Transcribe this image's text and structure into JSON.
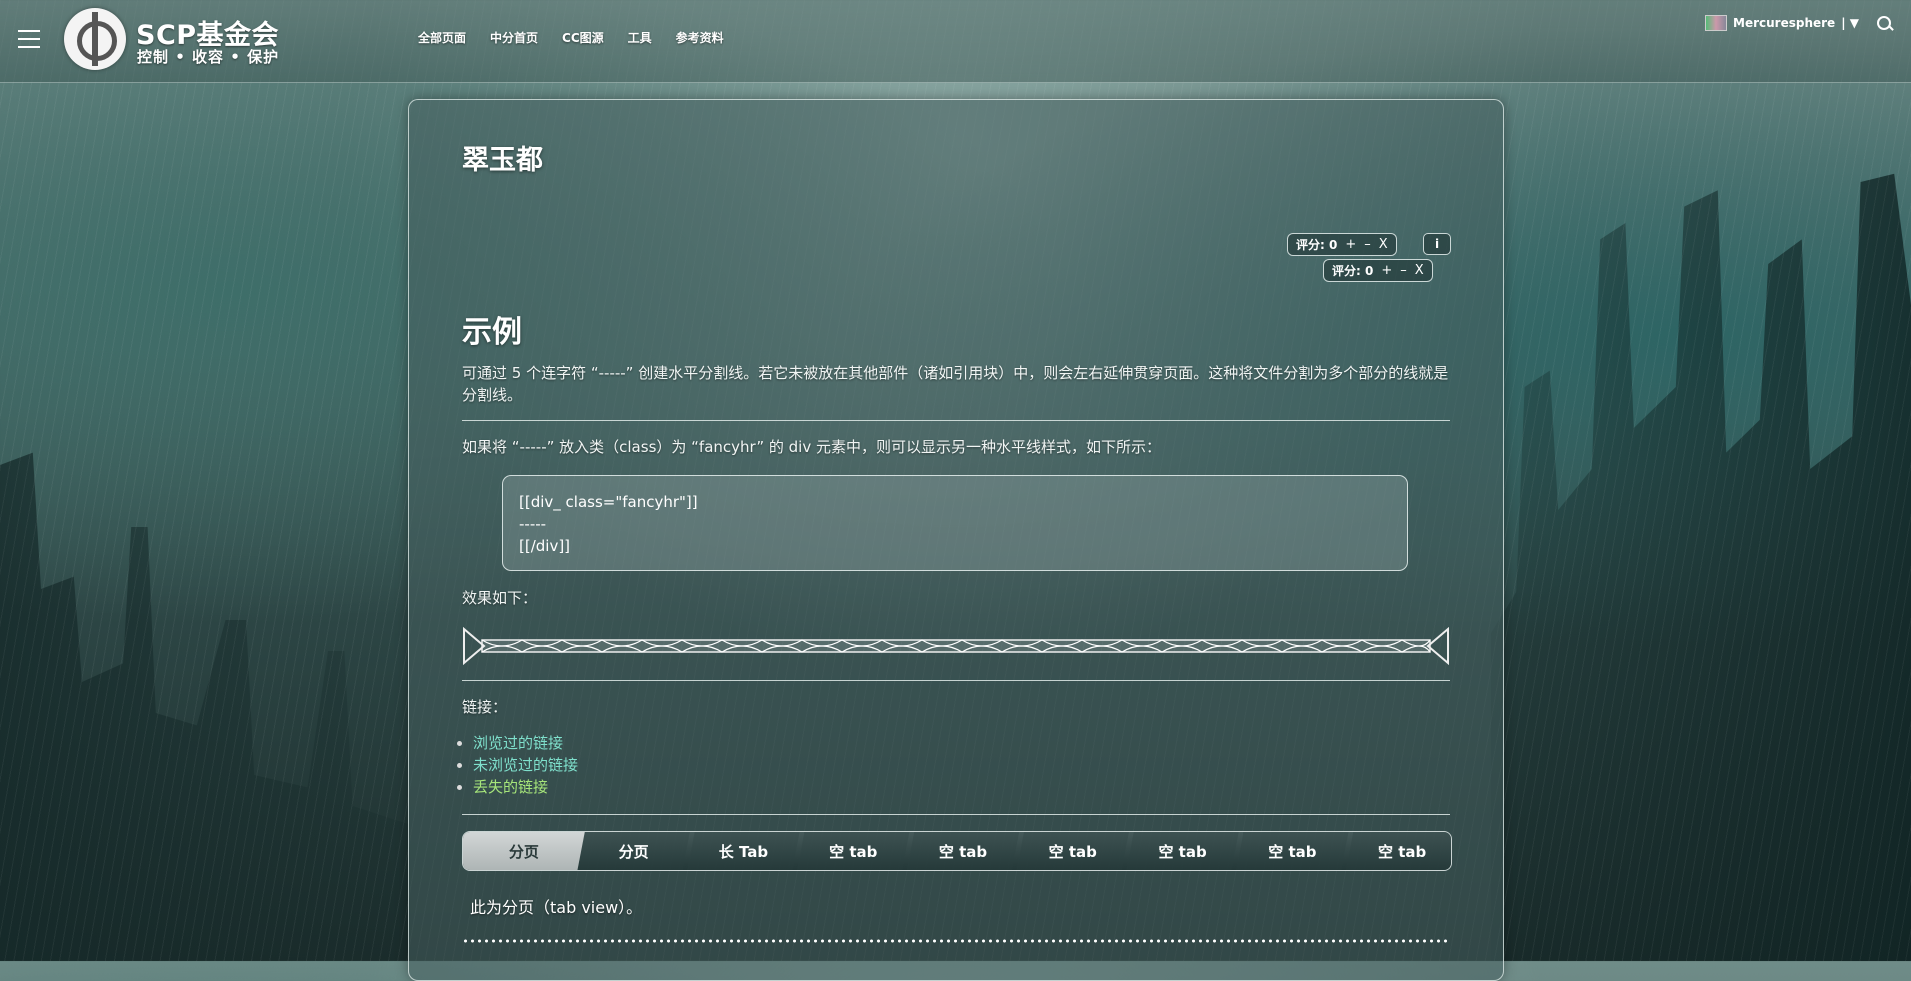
{
  "header": {
    "brand_title": "SCP基金会",
    "brand_subtitle": "控制 • 收容 • 保护",
    "nav": [
      "全部页面",
      "中分首页",
      "CC图源",
      "工具",
      "参考资料"
    ],
    "user": "Mercuresphere",
    "user_menu_arrow": "| ▼"
  },
  "page": {
    "title": "翠玉都",
    "rating1": {
      "label": "评分: 0",
      "plus": "+",
      "minus": "–",
      "cancel": "X"
    },
    "rating2": {
      "label": "评分: 0",
      "plus": "+",
      "minus": "–",
      "cancel": "X"
    },
    "info": "i",
    "section_heading": "示例",
    "para1": "可通过 5 个连字符 “-----” 创建水平分割线。若它未被放在其他部件（诸如引用块）中，则会左右延伸贯穿页面。这种将文件分割为多个部分的线就是分割线。",
    "para2": "如果将 “-----” 放入类（class）为 “fancyhr” 的 div 元素中，则可以显示另一种水平线样式，如下所示：",
    "code": [
      "[[div_ class=\"fancyhr\"]]",
      "-----",
      "[[/div]]"
    ],
    "para3": "效果如下：",
    "links_label": "链接：",
    "links": [
      {
        "text": "浏览过的链接"
      },
      {
        "text": "未浏览过的链接"
      },
      {
        "text": "丢失的链接"
      }
    ],
    "tabs": [
      "分页",
      "分页",
      "长 Tab",
      "空 tab",
      "空 tab",
      "空 tab",
      "空 tab",
      "空 tab",
      "空 tab"
    ],
    "active_tab": 0,
    "tab_content": "此为分页（tab view）。"
  },
  "colors": {
    "visited_link": "#7fe0cc",
    "unvisited_link": "#7fe0cc",
    "missing_link": "#a6e57a",
    "panel_border": "#e6f0ee"
  }
}
